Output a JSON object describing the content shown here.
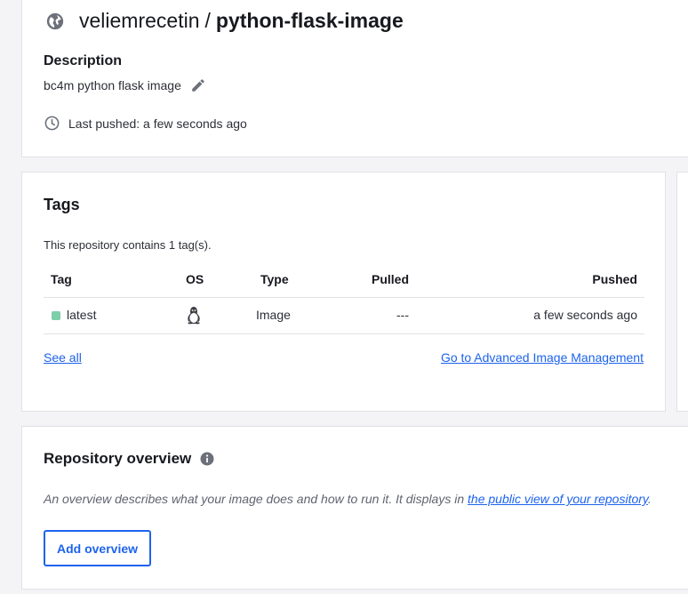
{
  "header": {
    "namespace": "veliemrecetin",
    "separator": "/",
    "repo_name": "python-flask-image",
    "description_heading": "Description",
    "description": "bc4m python flask image",
    "last_pushed": "Last pushed: a few seconds ago"
  },
  "tags": {
    "heading": "Tags",
    "count_text": "This repository contains 1 tag(s).",
    "columns": [
      "Tag",
      "OS",
      "Type",
      "Pulled",
      "Pushed"
    ],
    "rows": [
      {
        "tag": "latest",
        "os_icon": "linux-icon",
        "type": "Image",
        "pulled": "---",
        "pushed": "a few seconds ago",
        "status_color": "#7dcea9"
      }
    ],
    "see_all": "See all",
    "advanced_link": "Go to Advanced Image Management"
  },
  "overview": {
    "heading": "Repository overview",
    "description_prefix": "An overview describes what your image does and how to run it. It displays in ",
    "description_link": "the public view of your repository",
    "description_suffix": ".",
    "add_button": "Add overview"
  },
  "colors": {
    "accent": "#1d63ed",
    "status_active": "#7dcea9",
    "icon_gray": "#6c707a"
  }
}
